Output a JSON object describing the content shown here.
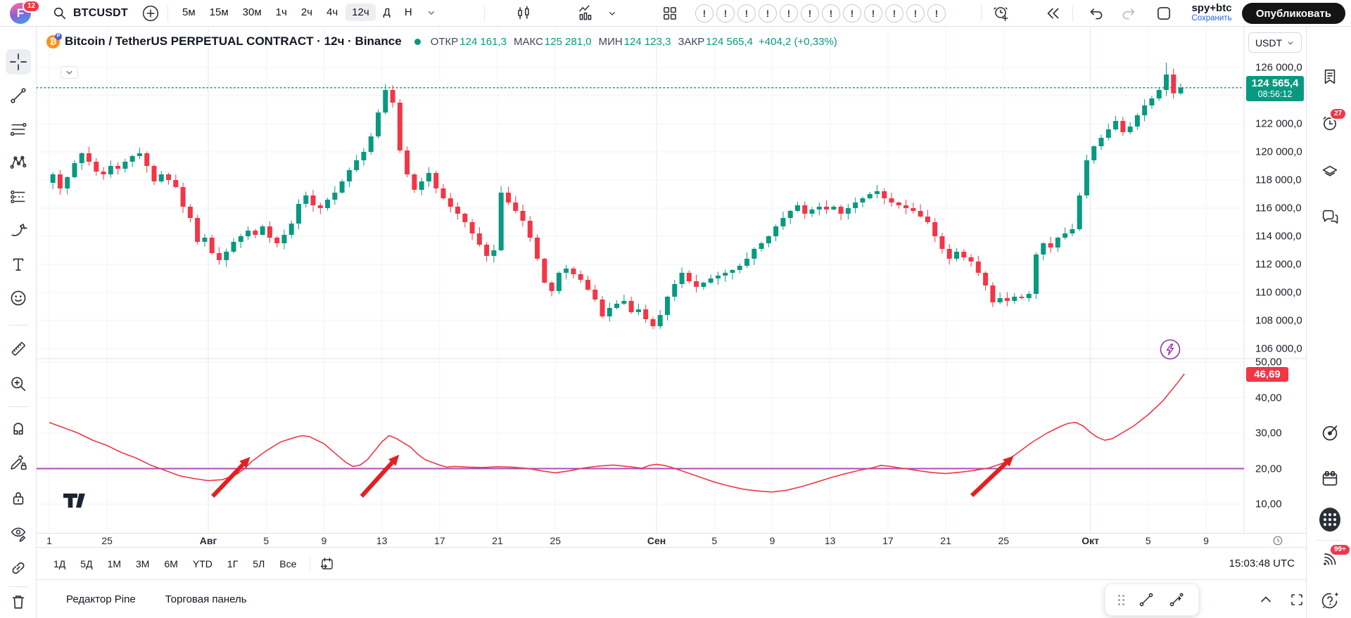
{
  "topbar": {
    "logo_badge": "12",
    "symbol": "BTCUSDT",
    "timeframes": [
      "5м",
      "15м",
      "30м",
      "1ч",
      "2ч",
      "4ч",
      "12ч",
      "Д",
      "Н"
    ],
    "active_timeframe": "12ч",
    "alert_placeholder_count": 12,
    "placeholder_glyph": "!",
    "username": "spy+btc",
    "save_label": "Сохранить",
    "publish_label": "Опубликовать"
  },
  "legend": {
    "title": "Bitcoin / TetherUS PERPETUAL CONTRACT · 12ч · Binance",
    "ohlc": [
      {
        "label": "ОТКР",
        "value": "124 161,3"
      },
      {
        "label": "МАКС",
        "value": "125 281,0"
      },
      {
        "label": "МИН",
        "value": "124 123,3"
      },
      {
        "label": "ЗАКР",
        "value": "124 565,4"
      }
    ],
    "change": "+404,2 (+0,33%)"
  },
  "price_scale": {
    "currency": "USDT",
    "ticks": [
      126000,
      122000,
      120000,
      118000,
      116000,
      114000,
      112000,
      110000,
      108000,
      106000
    ],
    "last_price": "124 565,4",
    "countdown": "08:56:12",
    "indicator_ticks": [
      50,
      40,
      30,
      20,
      10
    ],
    "indicator_value": "46,69"
  },
  "time_axis": {
    "labels": [
      [
        0,
        "1",
        0
      ],
      [
        4,
        "25",
        0
      ],
      [
        11,
        "Авг",
        1
      ],
      [
        15,
        "5",
        0
      ],
      [
        19,
        "9",
        0
      ],
      [
        23,
        "13",
        0
      ],
      [
        27,
        "17",
        0
      ],
      [
        31,
        "21",
        0
      ],
      [
        35,
        "25",
        0
      ],
      [
        42,
        "Сен",
        1
      ],
      [
        46,
        "5",
        0
      ],
      [
        50,
        "9",
        0
      ],
      [
        54,
        "13",
        0
      ],
      [
        58,
        "17",
        0
      ],
      [
        62,
        "21",
        0
      ],
      [
        66,
        "25",
        0
      ],
      [
        72,
        "Окт",
        1
      ],
      [
        76,
        "5",
        0
      ],
      [
        80,
        "9",
        0
      ]
    ]
  },
  "toolbar_bottom": {
    "ranges": [
      "1Д",
      "5Д",
      "1М",
      "3М",
      "6М",
      "YTD",
      "1Г",
      "5Л",
      "Все"
    ],
    "clock": "15:03:48 UTC"
  },
  "bottom_tabs": [
    "Редактор Pine",
    "Торговая панель"
  ],
  "colors": {
    "up": "#089981",
    "down": "#f23645",
    "indicator_line": "#f23645",
    "level_line": "#ad4bb8",
    "accent_blue": "#2962ff",
    "arrow_red": "#e32020",
    "lightning_purple": "#9334a8"
  },
  "chart_data": {
    "type": "candlestick+line",
    "symbol": "BTCUSDT",
    "timeframe": "12h",
    "last_price": 124565.4,
    "last_change": "+404,2 (+0,33%)",
    "price_pane": {
      "ylim": [
        105500,
        126500
      ],
      "grid_step": 2000,
      "note": "close-price path in thousands USDT; d = days since first visible candle (21 Jul), 2 candles per day",
      "close_path": [
        [
          0,
          117.8
        ],
        [
          0.5,
          118.4
        ],
        [
          1,
          117.4
        ],
        [
          1.5,
          118.2
        ],
        [
          2,
          119.2
        ],
        [
          2.5,
          119.9
        ],
        [
          3,
          119.3
        ],
        [
          3.5,
          118.6
        ],
        [
          4,
          118.4
        ],
        [
          4.5,
          119.0
        ],
        [
          5,
          118.8
        ],
        [
          5.5,
          119.3
        ],
        [
          6,
          119.7
        ],
        [
          6.5,
          119.9
        ],
        [
          7,
          119.0
        ],
        [
          7.5,
          117.9
        ],
        [
          8,
          118.4
        ],
        [
          8.5,
          118.0
        ],
        [
          9,
          117.5
        ],
        [
          9.5,
          116.1
        ],
        [
          10,
          115.3
        ],
        [
          10.5,
          113.6
        ],
        [
          11,
          113.9
        ],
        [
          11.5,
          112.8
        ],
        [
          12,
          112.3
        ],
        [
          12.5,
          112.9
        ],
        [
          13,
          113.6
        ],
        [
          13.5,
          114.0
        ],
        [
          14,
          114.4
        ],
        [
          14.5,
          114.1
        ],
        [
          15,
          114.7
        ],
        [
          15.5,
          113.9
        ],
        [
          16,
          113.5
        ],
        [
          16.5,
          114.1
        ],
        [
          17,
          114.9
        ],
        [
          17.5,
          116.3
        ],
        [
          18,
          116.9
        ],
        [
          18.5,
          116.2
        ],
        [
          19,
          116.0
        ],
        [
          19.5,
          116.6
        ],
        [
          20,
          117.1
        ],
        [
          20.5,
          117.9
        ],
        [
          21,
          118.7
        ],
        [
          21.5,
          119.4
        ],
        [
          22,
          120.0
        ],
        [
          22.5,
          121.1
        ],
        [
          23,
          122.8
        ],
        [
          23.5,
          124.4
        ],
        [
          24,
          123.5
        ],
        [
          24.5,
          120.1
        ],
        [
          25,
          118.4
        ],
        [
          25.5,
          117.3
        ],
        [
          26,
          117.9
        ],
        [
          26.5,
          118.5
        ],
        [
          27,
          117.4
        ],
        [
          27.5,
          116.7
        ],
        [
          28,
          116.1
        ],
        [
          28.5,
          115.6
        ],
        [
          29,
          115.0
        ],
        [
          29.5,
          114.2
        ],
        [
          30,
          113.4
        ],
        [
          30.5,
          112.6
        ],
        [
          31,
          113.0
        ],
        [
          31.5,
          117.1
        ],
        [
          32,
          116.4
        ],
        [
          32.5,
          115.8
        ],
        [
          33,
          115.1
        ],
        [
          33.5,
          113.9
        ],
        [
          34,
          112.4
        ],
        [
          34.5,
          110.7
        ],
        [
          35,
          110.1
        ],
        [
          35.5,
          111.4
        ],
        [
          36,
          111.7
        ],
        [
          36.5,
          111.3
        ],
        [
          37,
          110.9
        ],
        [
          37.5,
          110.2
        ],
        [
          38,
          109.5
        ],
        [
          38.5,
          108.3
        ],
        [
          39,
          108.9
        ],
        [
          39.5,
          109.2
        ],
        [
          40,
          109.4
        ],
        [
          40.5,
          108.6
        ],
        [
          41,
          108.8
        ],
        [
          41.5,
          108.1
        ],
        [
          42,
          107.6
        ],
        [
          42.5,
          108.4
        ],
        [
          43,
          109.7
        ],
        [
          43.5,
          110.6
        ],
        [
          44,
          111.4
        ],
        [
          44.5,
          110.8
        ],
        [
          45,
          110.4
        ],
        [
          45.5,
          110.7
        ],
        [
          46,
          111.0
        ],
        [
          46.5,
          111.2
        ],
        [
          47,
          111.4
        ],
        [
          47.5,
          111.6
        ],
        [
          48,
          111.9
        ],
        [
          48.5,
          112.4
        ],
        [
          49,
          113.1
        ],
        [
          49.5,
          113.5
        ],
        [
          50,
          114.0
        ],
        [
          50.5,
          114.7
        ],
        [
          51,
          115.3
        ],
        [
          51.5,
          115.8
        ],
        [
          52,
          116.2
        ],
        [
          52.5,
          115.6
        ],
        [
          53,
          115.9
        ],
        [
          53.5,
          116.1
        ],
        [
          54,
          115.9
        ],
        [
          54.5,
          116.1
        ],
        [
          55,
          115.6
        ],
        [
          55.5,
          116.0
        ],
        [
          56,
          116.4
        ],
        [
          56.5,
          116.7
        ],
        [
          57,
          117.0
        ],
        [
          57.5,
          117.2
        ],
        [
          58,
          116.7
        ],
        [
          58.5,
          116.4
        ],
        [
          59,
          116.2
        ],
        [
          59.5,
          116.0
        ],
        [
          60,
          115.8
        ],
        [
          60.5,
          115.4
        ],
        [
          61,
          115.0
        ],
        [
          61.5,
          114.0
        ],
        [
          62,
          113.1
        ],
        [
          62.5,
          112.4
        ],
        [
          63,
          112.9
        ],
        [
          63.5,
          112.5
        ],
        [
          64,
          112.2
        ],
        [
          64.5,
          111.4
        ],
        [
          65,
          110.5
        ],
        [
          65.5,
          109.3
        ],
        [
          66,
          109.6
        ],
        [
          66.5,
          109.4
        ],
        [
          67,
          109.7
        ],
        [
          67.5,
          109.6
        ],
        [
          68,
          109.9
        ],
        [
          68.5,
          112.7
        ],
        [
          69,
          113.5
        ],
        [
          69.5,
          113.2
        ],
        [
          70,
          113.9
        ],
        [
          70.5,
          114.2
        ],
        [
          71,
          114.5
        ],
        [
          71.5,
          116.9
        ],
        [
          72,
          119.4
        ],
        [
          72.5,
          120.4
        ],
        [
          73,
          121.0
        ],
        [
          73.5,
          121.6
        ],
        [
          74,
          122.2
        ],
        [
          74.5,
          121.4
        ],
        [
          75,
          121.8
        ],
        [
          75.5,
          122.6
        ],
        [
          76,
          123.3
        ],
        [
          76.5,
          123.8
        ],
        [
          77,
          124.4
        ],
        [
          77.5,
          125.5
        ],
        [
          78,
          124.161
        ],
        [
          78.5,
          124.565
        ]
      ]
    },
    "indicator_pane": {
      "name": "oscillator",
      "ylim": [
        8,
        52
      ],
      "level_line": 20,
      "last_value": 46.69,
      "path": [
        [
          0,
          33
        ],
        [
          1,
          31.5
        ],
        [
          2,
          30
        ],
        [
          3,
          28
        ],
        [
          4,
          26.5
        ],
        [
          5,
          24.5
        ],
        [
          6,
          23
        ],
        [
          7,
          21
        ],
        [
          8,
          19.5
        ],
        [
          9,
          18
        ],
        [
          10,
          17.2
        ],
        [
          11,
          16.6
        ],
        [
          12,
          16.9
        ],
        [
          13,
          18.5
        ],
        [
          13.5,
          20
        ],
        [
          14,
          22
        ],
        [
          15,
          25
        ],
        [
          16,
          27.5
        ],
        [
          17,
          28.8
        ],
        [
          17.5,
          29.3
        ],
        [
          18,
          29
        ],
        [
          19,
          27
        ],
        [
          20,
          23.5
        ],
        [
          20.5,
          21.8
        ],
        [
          21,
          20.6
        ],
        [
          21.5,
          21
        ],
        [
          22,
          22.5
        ],
        [
          22.5,
          25
        ],
        [
          23,
          27.5
        ],
        [
          23.5,
          29.3
        ],
        [
          24,
          28.5
        ],
        [
          25,
          26
        ],
        [
          25.5,
          24
        ],
        [
          26,
          22.5
        ],
        [
          27,
          21
        ],
        [
          27.5,
          20.4
        ],
        [
          28,
          20.6
        ],
        [
          29,
          20.4
        ],
        [
          30,
          20.3
        ],
        [
          31,
          20.5
        ],
        [
          32,
          20.4
        ],
        [
          33,
          20.1
        ],
        [
          34,
          19.4
        ],
        [
          35,
          18.8
        ],
        [
          36,
          19.4
        ],
        [
          37,
          20.2
        ],
        [
          38,
          20.7
        ],
        [
          39,
          21
        ],
        [
          40,
          20.6
        ],
        [
          41,
          20.1
        ],
        [
          41.5,
          20.9
        ],
        [
          42,
          21.2
        ],
        [
          42.5,
          20.9
        ],
        [
          43,
          20.4
        ],
        [
          44,
          19
        ],
        [
          45,
          17.6
        ],
        [
          46,
          16.2
        ],
        [
          47,
          15.1
        ],
        [
          48,
          14.2
        ],
        [
          49,
          13.7
        ],
        [
          50,
          13.4
        ],
        [
          51,
          13.9
        ],
        [
          52,
          14.9
        ],
        [
          53,
          16.1
        ],
        [
          54,
          17.4
        ],
        [
          55,
          18.5
        ],
        [
          56,
          19.5
        ],
        [
          57,
          20.3
        ],
        [
          57.5,
          20.9
        ],
        [
          58,
          20.7
        ],
        [
          59,
          20.1
        ],
        [
          60,
          19.5
        ],
        [
          61,
          18.9
        ],
        [
          62,
          18.6
        ],
        [
          63,
          19
        ],
        [
          64,
          19.5
        ],
        [
          65,
          20.2
        ],
        [
          66,
          21.6
        ],
        [
          67,
          24.5
        ],
        [
          68,
          27.5
        ],
        [
          69,
          30
        ],
        [
          70,
          32
        ],
        [
          70.5,
          32.8
        ],
        [
          71,
          33
        ],
        [
          71.5,
          32
        ],
        [
          72,
          30.2
        ],
        [
          72.5,
          28.8
        ],
        [
          73,
          28
        ],
        [
          73.5,
          28.4
        ],
        [
          74,
          29.6
        ],
        [
          75,
          32
        ],
        [
          76,
          35.2
        ],
        [
          77,
          39
        ],
        [
          77.5,
          41.5
        ],
        [
          78,
          44
        ],
        [
          78.5,
          46.69
        ]
      ],
      "arrows": [
        [
          11.3,
          12.2,
          13.9,
          23.3
        ],
        [
          21.6,
          12.2,
          24.2,
          23.9
        ],
        [
          63.8,
          12.4,
          66.7,
          23.6
        ]
      ]
    }
  }
}
